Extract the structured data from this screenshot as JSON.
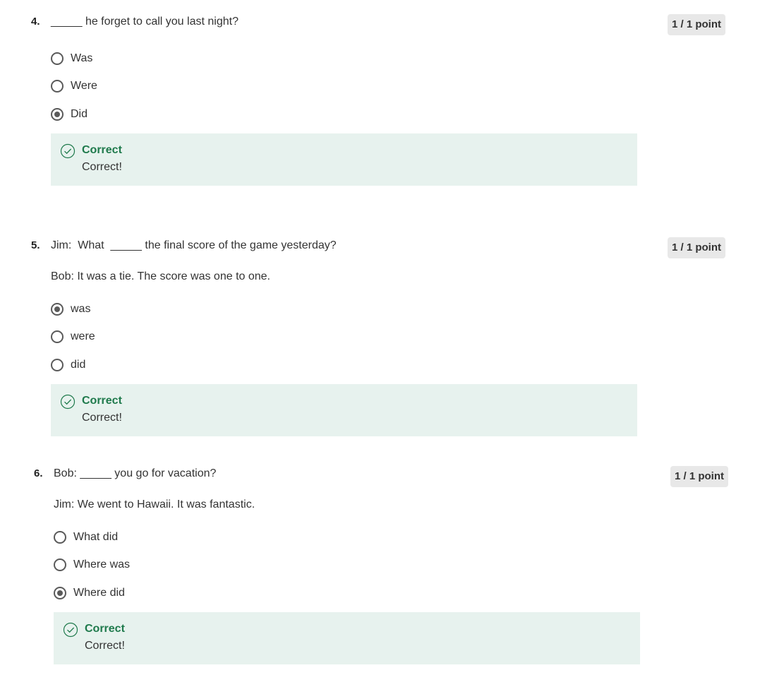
{
  "questions": [
    {
      "number": "4.",
      "text": "_____ he forget to call you last night?",
      "subtext": "",
      "points": "1 / 1 point",
      "options": [
        {
          "label": "Was",
          "checked": false
        },
        {
          "label": "Were",
          "checked": false
        },
        {
          "label": "Did",
          "checked": true
        }
      ],
      "feedback": {
        "title": "Correct",
        "body": "Correct!"
      }
    },
    {
      "number": "5.",
      "text": "Jim:  What  _____ the final score of the game yesterday?",
      "subtext": "Bob: It was a tie. The score was one to one.",
      "points": "1 / 1 point",
      "options": [
        {
          "label": "was",
          "checked": true
        },
        {
          "label": "were",
          "checked": false
        },
        {
          "label": "did",
          "checked": false
        }
      ],
      "feedback": {
        "title": "Correct",
        "body": "Correct!"
      }
    },
    {
      "number": "6.",
      "text": "Bob: _____ you go for vacation?",
      "subtext": "Jim: We went to Hawaii. It was fantastic.",
      "points": "1 / 1 point",
      "options": [
        {
          "label": "What did",
          "checked": false
        },
        {
          "label": "Where was",
          "checked": false
        },
        {
          "label": "Where did",
          "checked": true
        }
      ],
      "feedback": {
        "title": "Correct",
        "body": "Correct!"
      }
    }
  ],
  "colors": {
    "correct_text": "#1f7a4c",
    "feedback_bg": "#e7f2ee",
    "points_bg": "#e8e8e8",
    "radio_border": "#5a5a5a"
  },
  "icons": {
    "feedback": "check-circle-icon"
  }
}
